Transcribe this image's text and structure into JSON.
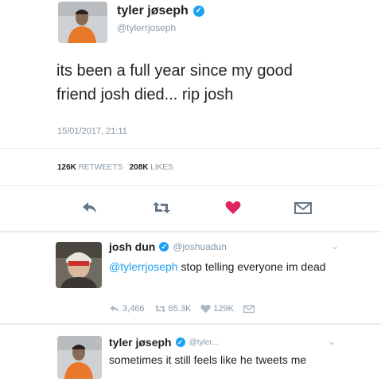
{
  "main_tweet": {
    "display_name": "tyler jøseph",
    "handle": "@tylerrjoseph",
    "text": "its been a full year since my good friend josh died... rip josh",
    "timestamp": "15/01/2017, 21:11",
    "retweet_count": "126K",
    "retweets_label": "RETWEETS",
    "like_count": "208K",
    "likes_label": "LIKES"
  },
  "reply1": {
    "display_name": "josh dun",
    "handle": "@joshuadun",
    "mention": "@tylerrjoseph",
    "text": "stop telling everyone im dead",
    "reply_count": "3,466",
    "retweet_count": "65.3K",
    "like_count": "129K"
  },
  "reply2": {
    "display_name": "tyler jøseph",
    "handle": "@tyler...",
    "text": "sometimes it still feels like he tweets me"
  },
  "colors": {
    "accent": "#1da1f2",
    "like": "#e0245e",
    "muted": "#8899a6",
    "avatar_shirt": "#e8792b"
  },
  "icons": [
    "verified-badge-icon",
    "reply-icon",
    "retweet-icon",
    "heart-icon",
    "dm-icon",
    "chevron-down-icon"
  ]
}
